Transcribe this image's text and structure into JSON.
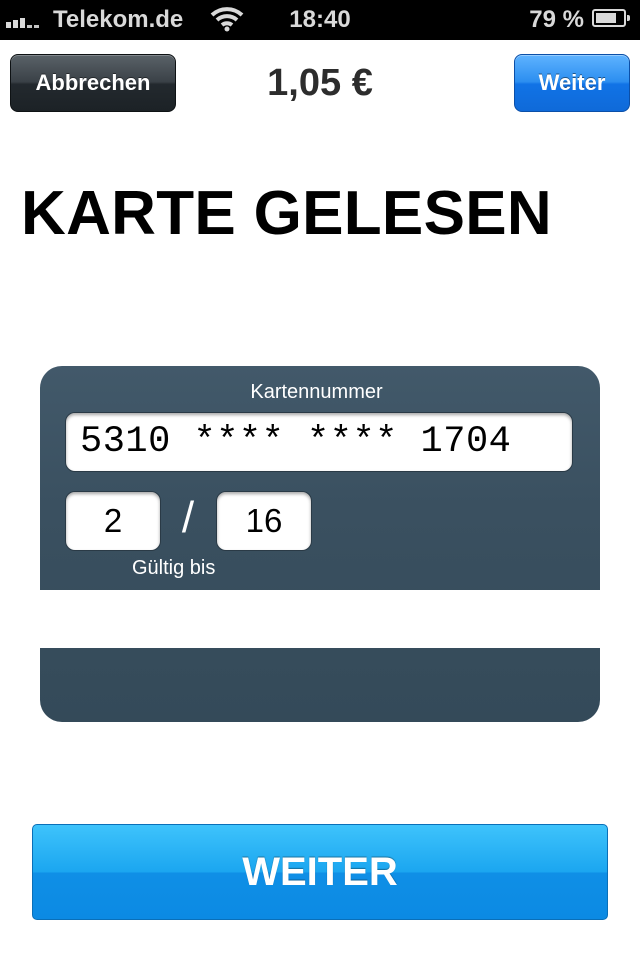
{
  "status_bar": {
    "carrier": "Telekom.de",
    "time": "18:40",
    "battery_percent": "79 %",
    "battery_level": 0.79,
    "signal_bars": 3,
    "icons": [
      "signal-icon",
      "wifi-icon",
      "battery-icon"
    ],
    "color": "#d9d9d9"
  },
  "nav": {
    "cancel_label": "Abbrechen",
    "amount": "1,05 €",
    "next_label": "Weiter",
    "colors": {
      "cancel_button": "#2e363c",
      "next_button": "#1a7ff0"
    }
  },
  "page": {
    "title": "KARTE GELESEN"
  },
  "card": {
    "number_label": "Kartennummer",
    "number": "5310 **** **** 1704",
    "expiry_month": "2",
    "expiry_separator": "/",
    "expiry_year": "16",
    "valid_label": "Gültig bis",
    "color": "#3a5060"
  },
  "actions": {
    "continue_label": "WEITER",
    "color": "#1ba6f0"
  }
}
